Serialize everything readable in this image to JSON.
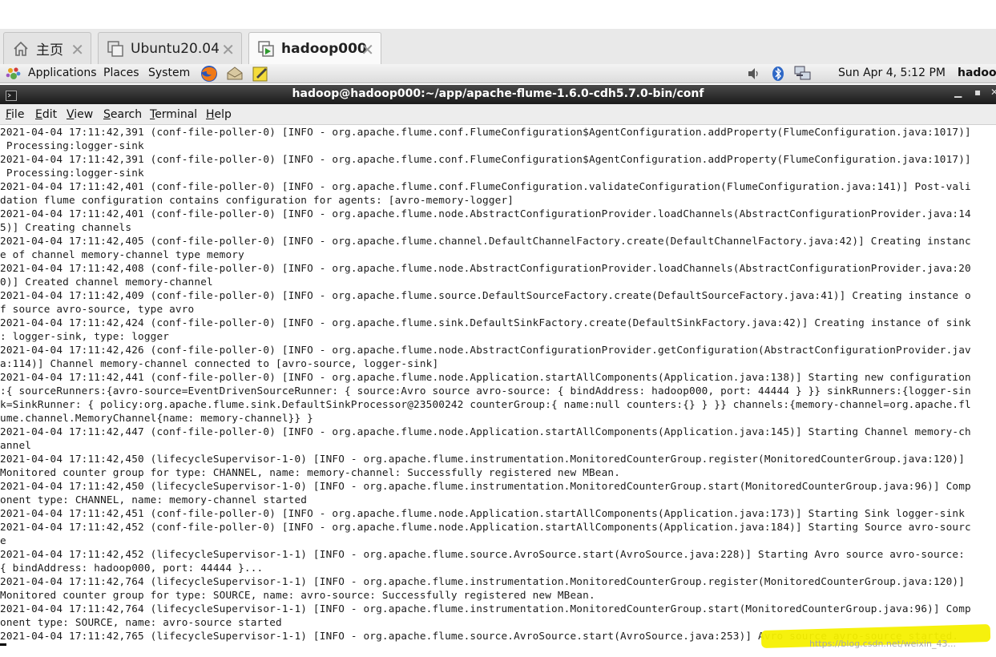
{
  "vm_tabs": [
    {
      "label": "主页",
      "icon": "home-icon"
    },
    {
      "label": "Ubuntu20.04",
      "icon": "vm-icon"
    },
    {
      "label": "hadoop000",
      "icon": "vm-running-icon"
    }
  ],
  "panel": {
    "applications": "Applications",
    "places": "Places",
    "system": "System",
    "clock": "Sun Apr  4,  5:12 PM",
    "user": "hadoop"
  },
  "window": {
    "title": "hadoop@hadoop000:~/app/apache-flume-1.6.0-cdh5.7.0-bin/conf"
  },
  "menu": {
    "file": {
      "u": "F",
      "rest": "ile"
    },
    "edit": {
      "u": "E",
      "rest": "dit"
    },
    "view": {
      "u": "V",
      "rest": "iew"
    },
    "search": {
      "u": "S",
      "rest": "earch"
    },
    "terminal": {
      "u": "T",
      "rest": "erminal"
    },
    "help": {
      "u": "H",
      "rest": "elp"
    }
  },
  "terminal": {
    "lines": [
      "2021-04-04 17:11:42,391 (conf-file-poller-0) [INFO - org.apache.flume.conf.FlumeConfiguration$AgentConfiguration.addProperty(FlumeConfiguration.java:1017)]",
      " Processing:logger-sink",
      "2021-04-04 17:11:42,391 (conf-file-poller-0) [INFO - org.apache.flume.conf.FlumeConfiguration$AgentConfiguration.addProperty(FlumeConfiguration.java:1017)]",
      " Processing:logger-sink",
      "2021-04-04 17:11:42,401 (conf-file-poller-0) [INFO - org.apache.flume.conf.FlumeConfiguration.validateConfiguration(FlumeConfiguration.java:141)] Post-vali",
      "dation flume configuration contains configuration for agents: [avro-memory-logger]",
      "2021-04-04 17:11:42,401 (conf-file-poller-0) [INFO - org.apache.flume.node.AbstractConfigurationProvider.loadChannels(AbstractConfigurationProvider.java:14",
      "5)] Creating channels",
      "2021-04-04 17:11:42,405 (conf-file-poller-0) [INFO - org.apache.flume.channel.DefaultChannelFactory.create(DefaultChannelFactory.java:42)] Creating instanc",
      "e of channel memory-channel type memory",
      "2021-04-04 17:11:42,408 (conf-file-poller-0) [INFO - org.apache.flume.node.AbstractConfigurationProvider.loadChannels(AbstractConfigurationProvider.java:20",
      "0)] Created channel memory-channel",
      "2021-04-04 17:11:42,409 (conf-file-poller-0) [INFO - org.apache.flume.source.DefaultSourceFactory.create(DefaultSourceFactory.java:41)] Creating instance o",
      "f source avro-source, type avro",
      "2021-04-04 17:11:42,424 (conf-file-poller-0) [INFO - org.apache.flume.sink.DefaultSinkFactory.create(DefaultSinkFactory.java:42)] Creating instance of sink",
      ": logger-sink, type: logger",
      "2021-04-04 17:11:42,426 (conf-file-poller-0) [INFO - org.apache.flume.node.AbstractConfigurationProvider.getConfiguration(AbstractConfigurationProvider.jav",
      "a:114)] Channel memory-channel connected to [avro-source, logger-sink]",
      "2021-04-04 17:11:42,441 (conf-file-poller-0) [INFO - org.apache.flume.node.Application.startAllComponents(Application.java:138)] Starting new configuration",
      ":{ sourceRunners:{avro-source=EventDrivenSourceRunner: { source:Avro source avro-source: { bindAddress: hadoop000, port: 44444 } }} sinkRunners:{logger-sin",
      "k=SinkRunner: { policy:org.apache.flume.sink.DefaultSinkProcessor@23500242 counterGroup:{ name:null counters:{} } }} channels:{memory-channel=org.apache.fl",
      "ume.channel.MemoryChannel{name: memory-channel}} }",
      "2021-04-04 17:11:42,447 (conf-file-poller-0) [INFO - org.apache.flume.node.Application.startAllComponents(Application.java:145)] Starting Channel memory-ch",
      "annel",
      "2021-04-04 17:11:42,450 (lifecycleSupervisor-1-0) [INFO - org.apache.flume.instrumentation.MonitoredCounterGroup.register(MonitoredCounterGroup.java:120)]",
      "Monitored counter group for type: CHANNEL, name: memory-channel: Successfully registered new MBean.",
      "2021-04-04 17:11:42,450 (lifecycleSupervisor-1-0) [INFO - org.apache.flume.instrumentation.MonitoredCounterGroup.start(MonitoredCounterGroup.java:96)] Comp",
      "onent type: CHANNEL, name: memory-channel started",
      "2021-04-04 17:11:42,451 (conf-file-poller-0) [INFO - org.apache.flume.node.Application.startAllComponents(Application.java:173)] Starting Sink logger-sink",
      "2021-04-04 17:11:42,452 (conf-file-poller-0) [INFO - org.apache.flume.node.Application.startAllComponents(Application.java:184)] Starting Source avro-sourc",
      "e",
      "2021-04-04 17:11:42,452 (lifecycleSupervisor-1-1) [INFO - org.apache.flume.source.AvroSource.start(AvroSource.java:228)] Starting Avro source avro-source:",
      "{ bindAddress: hadoop000, port: 44444 }...",
      "2021-04-04 17:11:42,764 (lifecycleSupervisor-1-1) [INFO - org.apache.flume.instrumentation.MonitoredCounterGroup.register(MonitoredCounterGroup.java:120)]",
      "Monitored counter group for type: SOURCE, name: avro-source: Successfully registered new MBean.",
      "2021-04-04 17:11:42,764 (lifecycleSupervisor-1-1) [INFO - org.apache.flume.instrumentation.MonitoredCounterGroup.start(MonitoredCounterGroup.java:96)] Comp",
      "onent type: SOURCE, name: avro-source started",
      "2021-04-04 17:11:42,765 (lifecycleSupervisor-1-1) [INFO - org.apache.flume.source.AvroSource.start(AvroSource.java:253)] Avro source avro-source started."
    ],
    "watermark": "https://blog.csdn.net/weixin_43..."
  },
  "colors": {
    "highlight": "#f5f000",
    "titlebar": "#2a2a2a",
    "terminal_bg": "#ffffff"
  }
}
